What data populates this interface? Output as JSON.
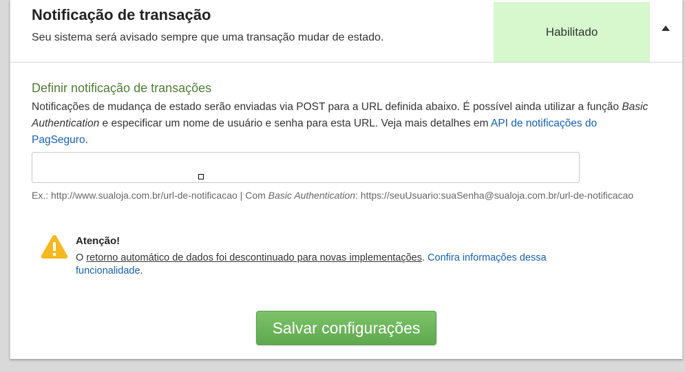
{
  "header": {
    "title": "Notificação de transação",
    "subtitle": "Seu sistema será avisado sempre que uma transação mudar de estado.",
    "status": "Habilitado",
    "status_color": "#d6f8cc"
  },
  "section": {
    "title": "Definir notificação de transações",
    "desc_part1": "Notificações de mudança de estado serão enviadas via POST para a URL definida abaixo. É possível ainda utilizar a função ",
    "desc_em": "Basic Authentication",
    "desc_part2": " e especificar um nome de usuário e senha para esta URL. Veja mais detalhes em ",
    "desc_link": "API de notificações do PagSeguro",
    "desc_end": "."
  },
  "url_field": {
    "value": ""
  },
  "example": {
    "prefix": "Ex.: http://www.sualoja.com.br/url-de-notificacao | Com ",
    "em": "Basic Authentication",
    "suffix": ": https://seuUsuario:suaSenha@sualoja.com.br/url-de-notificacao"
  },
  "notice": {
    "title": "Atenção!",
    "text_start": "O ",
    "underlined": "retorno automático de dados foi descontinuado para novas implementações",
    "text_mid": ". ",
    "link": "Confira informações dessa funcionalidade",
    "text_end": "."
  },
  "save_button": "Salvar configurações",
  "colors": {
    "accent_green": "#4e7d34",
    "link_blue": "#1560b0",
    "button_green": "#6ab559",
    "warning_yellow": "#f5b820"
  },
  "icons": {
    "toggle": "triangle-up-icon",
    "warning": "warning-icon"
  }
}
